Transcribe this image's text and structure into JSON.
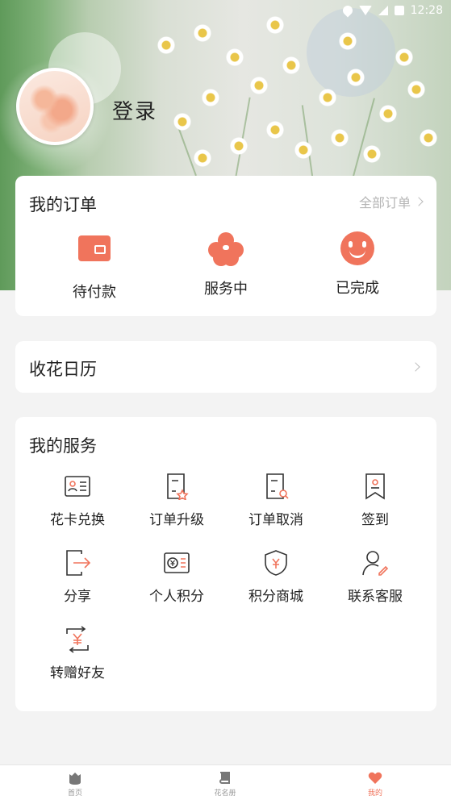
{
  "status_bar": {
    "time": "12:28"
  },
  "profile": {
    "login_label": "登录"
  },
  "orders": {
    "title": "我的订单",
    "all_orders_label": "全部订单",
    "items": [
      {
        "label": "待付款",
        "icon": "wallet-icon"
      },
      {
        "label": "服务中",
        "icon": "flower-icon"
      },
      {
        "label": "已完成",
        "icon": "smile-icon"
      }
    ]
  },
  "calendar": {
    "title": "收花日历"
  },
  "services": {
    "title": "我的服务",
    "items": [
      {
        "label": "花卡兑换",
        "icon": "card-icon"
      },
      {
        "label": "订单升级",
        "icon": "order-upgrade-icon"
      },
      {
        "label": "订单取消",
        "icon": "order-cancel-icon"
      },
      {
        "label": "签到",
        "icon": "bookmark-icon"
      },
      {
        "label": "分享",
        "icon": "share-icon"
      },
      {
        "label": "个人积分",
        "icon": "points-icon"
      },
      {
        "label": "积分商城",
        "icon": "shield-yen-icon"
      },
      {
        "label": "联系客服",
        "icon": "customer-service-icon"
      },
      {
        "label": "转赠好友",
        "icon": "transfer-icon"
      }
    ]
  },
  "tabbar": {
    "items": [
      {
        "label": "首页",
        "icon": "home-icon"
      },
      {
        "label": "花名册",
        "icon": "book-icon"
      },
      {
        "label": "我的",
        "icon": "heart-icon"
      }
    ]
  },
  "colors": {
    "accent": "#f0745c",
    "background": "#f3f3f3",
    "muted": "#b5b5b5"
  }
}
